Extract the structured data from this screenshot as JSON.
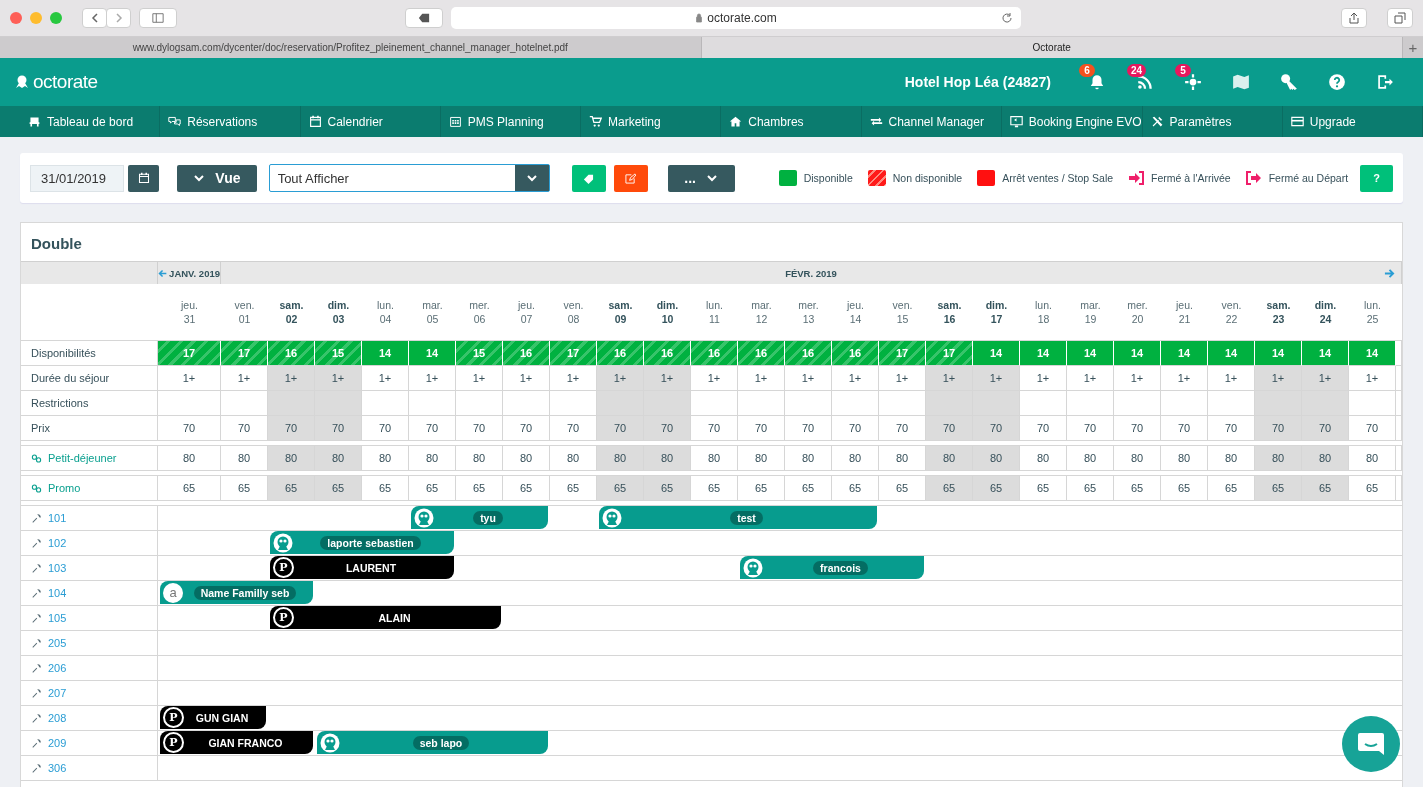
{
  "browser": {
    "url": "octorate.com",
    "tabs": [
      {
        "title": "www.dylogsam.com/dycenter/doc/reservation/Profitez_pleinement_channel_manager_hotelnet.pdf",
        "selected": false
      },
      {
        "title": "Octorate",
        "selected": true
      }
    ],
    "new_tab": "+"
  },
  "header": {
    "logo": "octorate",
    "hotel": "Hotel Hop Léa (24827)",
    "icons": [
      {
        "kind": "bell",
        "badge": "6",
        "color": "#f4511e"
      },
      {
        "kind": "rss",
        "badge": "24",
        "color": "#e8175d"
      },
      {
        "kind": "crosshair",
        "badge": "5",
        "color": "#e8175d"
      },
      {
        "kind": "map"
      },
      {
        "kind": "key"
      },
      {
        "kind": "help"
      },
      {
        "kind": "logout"
      }
    ]
  },
  "nav": [
    {
      "label": "Tableau de bord",
      "kind": "chair"
    },
    {
      "label": "Réservations",
      "kind": "bubbles"
    },
    {
      "label": "Calendrier",
      "kind": "calendar"
    },
    {
      "label": "PMS Planning",
      "kind": "grid"
    },
    {
      "label": "Marketing",
      "kind": "cart"
    },
    {
      "label": "Chambres",
      "kind": "house"
    },
    {
      "label": "Channel Manager",
      "kind": "arrows"
    },
    {
      "label": "Booking Engine EVO",
      "kind": "monitor"
    },
    {
      "label": "Paramètres",
      "kind": "tools"
    },
    {
      "label": "Upgrade",
      "kind": "card"
    }
  ],
  "toolbar": {
    "date": "31/01/2019",
    "view_button": "Vue",
    "filter": "Tout Afficher",
    "more_button": "...",
    "help_button": "?",
    "legend": [
      {
        "label": "Disponible",
        "kind": "solid",
        "color": "#00b140"
      },
      {
        "label": "Non disponible",
        "kind": "hatched",
        "color": "#ff1a1a"
      },
      {
        "label": "Arrêt ventes / Stop Sale",
        "kind": "solid",
        "color": "#ff1010"
      },
      {
        "label": "Fermé à l'Arrivée",
        "kind": "arrival",
        "color": "#ef1f6a"
      },
      {
        "label": "Fermé au Départ",
        "kind": "departure",
        "color": "#ef1f6a"
      }
    ]
  },
  "calendar": {
    "title": "Double",
    "months": [
      {
        "label": "JANV. 2019",
        "days": [
          {
            "name": "jeu.",
            "num": "31",
            "weekend": false
          }
        ]
      },
      {
        "label": "FÉVR. 2019",
        "days": [
          {
            "name": "ven.",
            "num": "01",
            "weekend": false
          },
          {
            "name": "sam.",
            "num": "02",
            "weekend": true
          },
          {
            "name": "dim.",
            "num": "03",
            "weekend": true
          },
          {
            "name": "lun.",
            "num": "04",
            "weekend": false
          },
          {
            "name": "mar.",
            "num": "05",
            "weekend": false
          },
          {
            "name": "mer.",
            "num": "06",
            "weekend": false
          },
          {
            "name": "jeu.",
            "num": "07",
            "weekend": false
          },
          {
            "name": "ven.",
            "num": "08",
            "weekend": false
          },
          {
            "name": "sam.",
            "num": "09",
            "weekend": true
          },
          {
            "name": "dim.",
            "num": "10",
            "weekend": true
          },
          {
            "name": "lun.",
            "num": "11",
            "weekend": false
          },
          {
            "name": "mar.",
            "num": "12",
            "weekend": false
          },
          {
            "name": "mer.",
            "num": "13",
            "weekend": false
          },
          {
            "name": "jeu.",
            "num": "14",
            "weekend": false
          },
          {
            "name": "ven.",
            "num": "15",
            "weekend": false
          },
          {
            "name": "sam.",
            "num": "16",
            "weekend": true
          },
          {
            "name": "dim.",
            "num": "17",
            "weekend": true
          },
          {
            "name": "lun.",
            "num": "18",
            "weekend": false
          },
          {
            "name": "mar.",
            "num": "19",
            "weekend": false
          },
          {
            "name": "mer.",
            "num": "20",
            "weekend": false
          },
          {
            "name": "jeu.",
            "num": "21",
            "weekend": false
          },
          {
            "name": "ven.",
            "num": "22",
            "weekend": false
          },
          {
            "name": "sam.",
            "num": "23",
            "weekend": true
          },
          {
            "name": "dim.",
            "num": "24",
            "weekend": true
          },
          {
            "name": "lun.",
            "num": "25",
            "weekend": false
          }
        ]
      }
    ],
    "rates": [
      {
        "label": "Disponibilités",
        "kind": "availability",
        "cells": [
          {
            "value": "17",
            "hatched": true
          },
          {
            "value": "17",
            "hatched": true
          },
          {
            "value": "16",
            "hatched": true
          },
          {
            "value": "15",
            "hatched": true
          },
          {
            "value": "14",
            "hatched": false
          },
          {
            "value": "14",
            "hatched": false
          },
          {
            "value": "15",
            "hatched": true
          },
          {
            "value": "16",
            "hatched": true
          },
          {
            "value": "17",
            "hatched": true
          },
          {
            "value": "16",
            "hatched": true
          },
          {
            "value": "16",
            "hatched": true
          },
          {
            "value": "16",
            "hatched": true
          },
          {
            "value": "16",
            "hatched": true
          },
          {
            "value": "16",
            "hatched": true
          },
          {
            "value": "16",
            "hatched": true
          },
          {
            "value": "17",
            "hatched": true
          },
          {
            "value": "17",
            "hatched": true
          },
          {
            "value": "14",
            "hatched": false
          },
          {
            "value": "14",
            "hatched": false
          },
          {
            "value": "14",
            "hatched": false
          },
          {
            "value": "14",
            "hatched": false
          },
          {
            "value": "14",
            "hatched": false
          },
          {
            "value": "14",
            "hatched": false
          },
          {
            "value": "14",
            "hatched": false
          },
          {
            "value": "14",
            "hatched": false
          },
          {
            "value": "14",
            "hatched": false
          }
        ]
      },
      {
        "label": "Durée du séjour",
        "kind": "plain",
        "cells": [
          "1+",
          "1+",
          "1+",
          "1+",
          "1+",
          "1+",
          "1+",
          "1+",
          "1+",
          "1+",
          "1+",
          "1+",
          "1+",
          "1+",
          "1+",
          "1+",
          "1+",
          "1+",
          "1+",
          "1+",
          "1+",
          "1+",
          "1+",
          "1+",
          "1+",
          "1+"
        ]
      },
      {
        "label": "Restrictions",
        "kind": "plain"
      },
      {
        "label": "Prix",
        "kind": "plain",
        "cells": [
          "70",
          "70",
          "70",
          "70",
          "70",
          "70",
          "70",
          "70",
          "70",
          "70",
          "70",
          "70",
          "70",
          "70",
          "70",
          "70",
          "70",
          "70",
          "70",
          "70",
          "70",
          "70",
          "70",
          "70",
          "70",
          "70"
        ]
      },
      {
        "label": "Petit-déjeuner",
        "kind": "linked",
        "cells": [
          "80",
          "80",
          "80",
          "80",
          "80",
          "80",
          "80",
          "80",
          "80",
          "80",
          "80",
          "80",
          "80",
          "80",
          "80",
          "80",
          "80",
          "80",
          "80",
          "80",
          "80",
          "80",
          "80",
          "80",
          "80",
          "80"
        ]
      },
      {
        "label": "Promo",
        "kind": "linked",
        "cells": [
          "65",
          "65",
          "65",
          "65",
          "65",
          "65",
          "65",
          "65",
          "65",
          "65",
          "65",
          "65",
          "65",
          "65",
          "65",
          "65",
          "65",
          "65",
          "65",
          "65",
          "65",
          "65",
          "65",
          "65",
          "65",
          "65"
        ]
      }
    ],
    "rooms": [
      {
        "number": "101",
        "timeline": [
          {
            "kind": "free"
          },
          {
            "kind": "free"
          },
          {
            "kind": "free"
          },
          {
            "kind": "free"
          },
          {
            "kind": "free"
          },
          {
            "kind": "channel",
            "guest": "tyu"
          },
          {
            "kind": "stay"
          },
          {
            "kind": "stay"
          },
          {
            "kind": "free"
          },
          {
            "kind": "channel",
            "guest": "test"
          },
          {
            "kind": "stay"
          },
          {
            "kind": "stay"
          },
          {
            "kind": "stay"
          },
          {
            "kind": "stay"
          },
          {
            "kind": "stay"
          }
        ]
      },
      {
        "number": "102",
        "timeline": [
          {
            "kind": "free"
          },
          {
            "kind": "free"
          },
          {
            "kind": "channel",
            "guest": "laporte sebastien"
          },
          {
            "kind": "stay"
          },
          {
            "kind": "stay"
          },
          {
            "kind": "stay"
          }
        ]
      },
      {
        "number": "103",
        "timeline": [
          {
            "kind": "free"
          },
          {
            "kind": "free"
          },
          {
            "kind": "direct",
            "guest": "LAURENT",
            "badge": "P"
          },
          {
            "kind": "stay"
          },
          {
            "kind": "stay"
          },
          {
            "kind": "stay"
          },
          {
            "kind": "free"
          },
          {
            "kind": "free"
          },
          {
            "kind": "free"
          },
          {
            "kind": "free"
          },
          {
            "kind": "free"
          },
          {
            "kind": "free"
          },
          {
            "kind": "channel",
            "guest": "francois"
          },
          {
            "kind": "stay"
          },
          {
            "kind": "stay"
          },
          {
            "kind": "stay"
          }
        ]
      },
      {
        "number": "104",
        "timeline": [
          {
            "kind": "channel",
            "guest": "Name Familly seb",
            "badge": "a"
          },
          {
            "kind": "stay"
          },
          {
            "kind": "stay"
          }
        ]
      },
      {
        "number": "105",
        "timeline": [
          {
            "kind": "free"
          },
          {
            "kind": "free"
          },
          {
            "kind": "direct",
            "guest": "ALAIN",
            "badge": "P"
          },
          {
            "kind": "stay"
          },
          {
            "kind": "stay"
          },
          {
            "kind": "stay"
          },
          {
            "kind": "stay"
          }
        ]
      },
      {
        "number": "205"
      },
      {
        "number": "206"
      },
      {
        "number": "207"
      },
      {
        "number": "208",
        "timeline": [
          {
            "kind": "direct",
            "guest": "GUN GIAN",
            "badge": "P"
          },
          {
            "kind": "stay"
          }
        ]
      },
      {
        "number": "209",
        "timeline": [
          {
            "kind": "direct",
            "guest": "GIAN FRANCO",
            "badge": "P"
          },
          {
            "kind": "stay"
          },
          {
            "kind": "stay"
          },
          {
            "kind": "channel",
            "guest": "seb lapo"
          },
          {
            "kind": "stay"
          },
          {
            "kind": "stay"
          },
          {
            "kind": "stay"
          },
          {
            "kind": "stay"
          }
        ]
      },
      {
        "number": "306"
      }
    ]
  }
}
